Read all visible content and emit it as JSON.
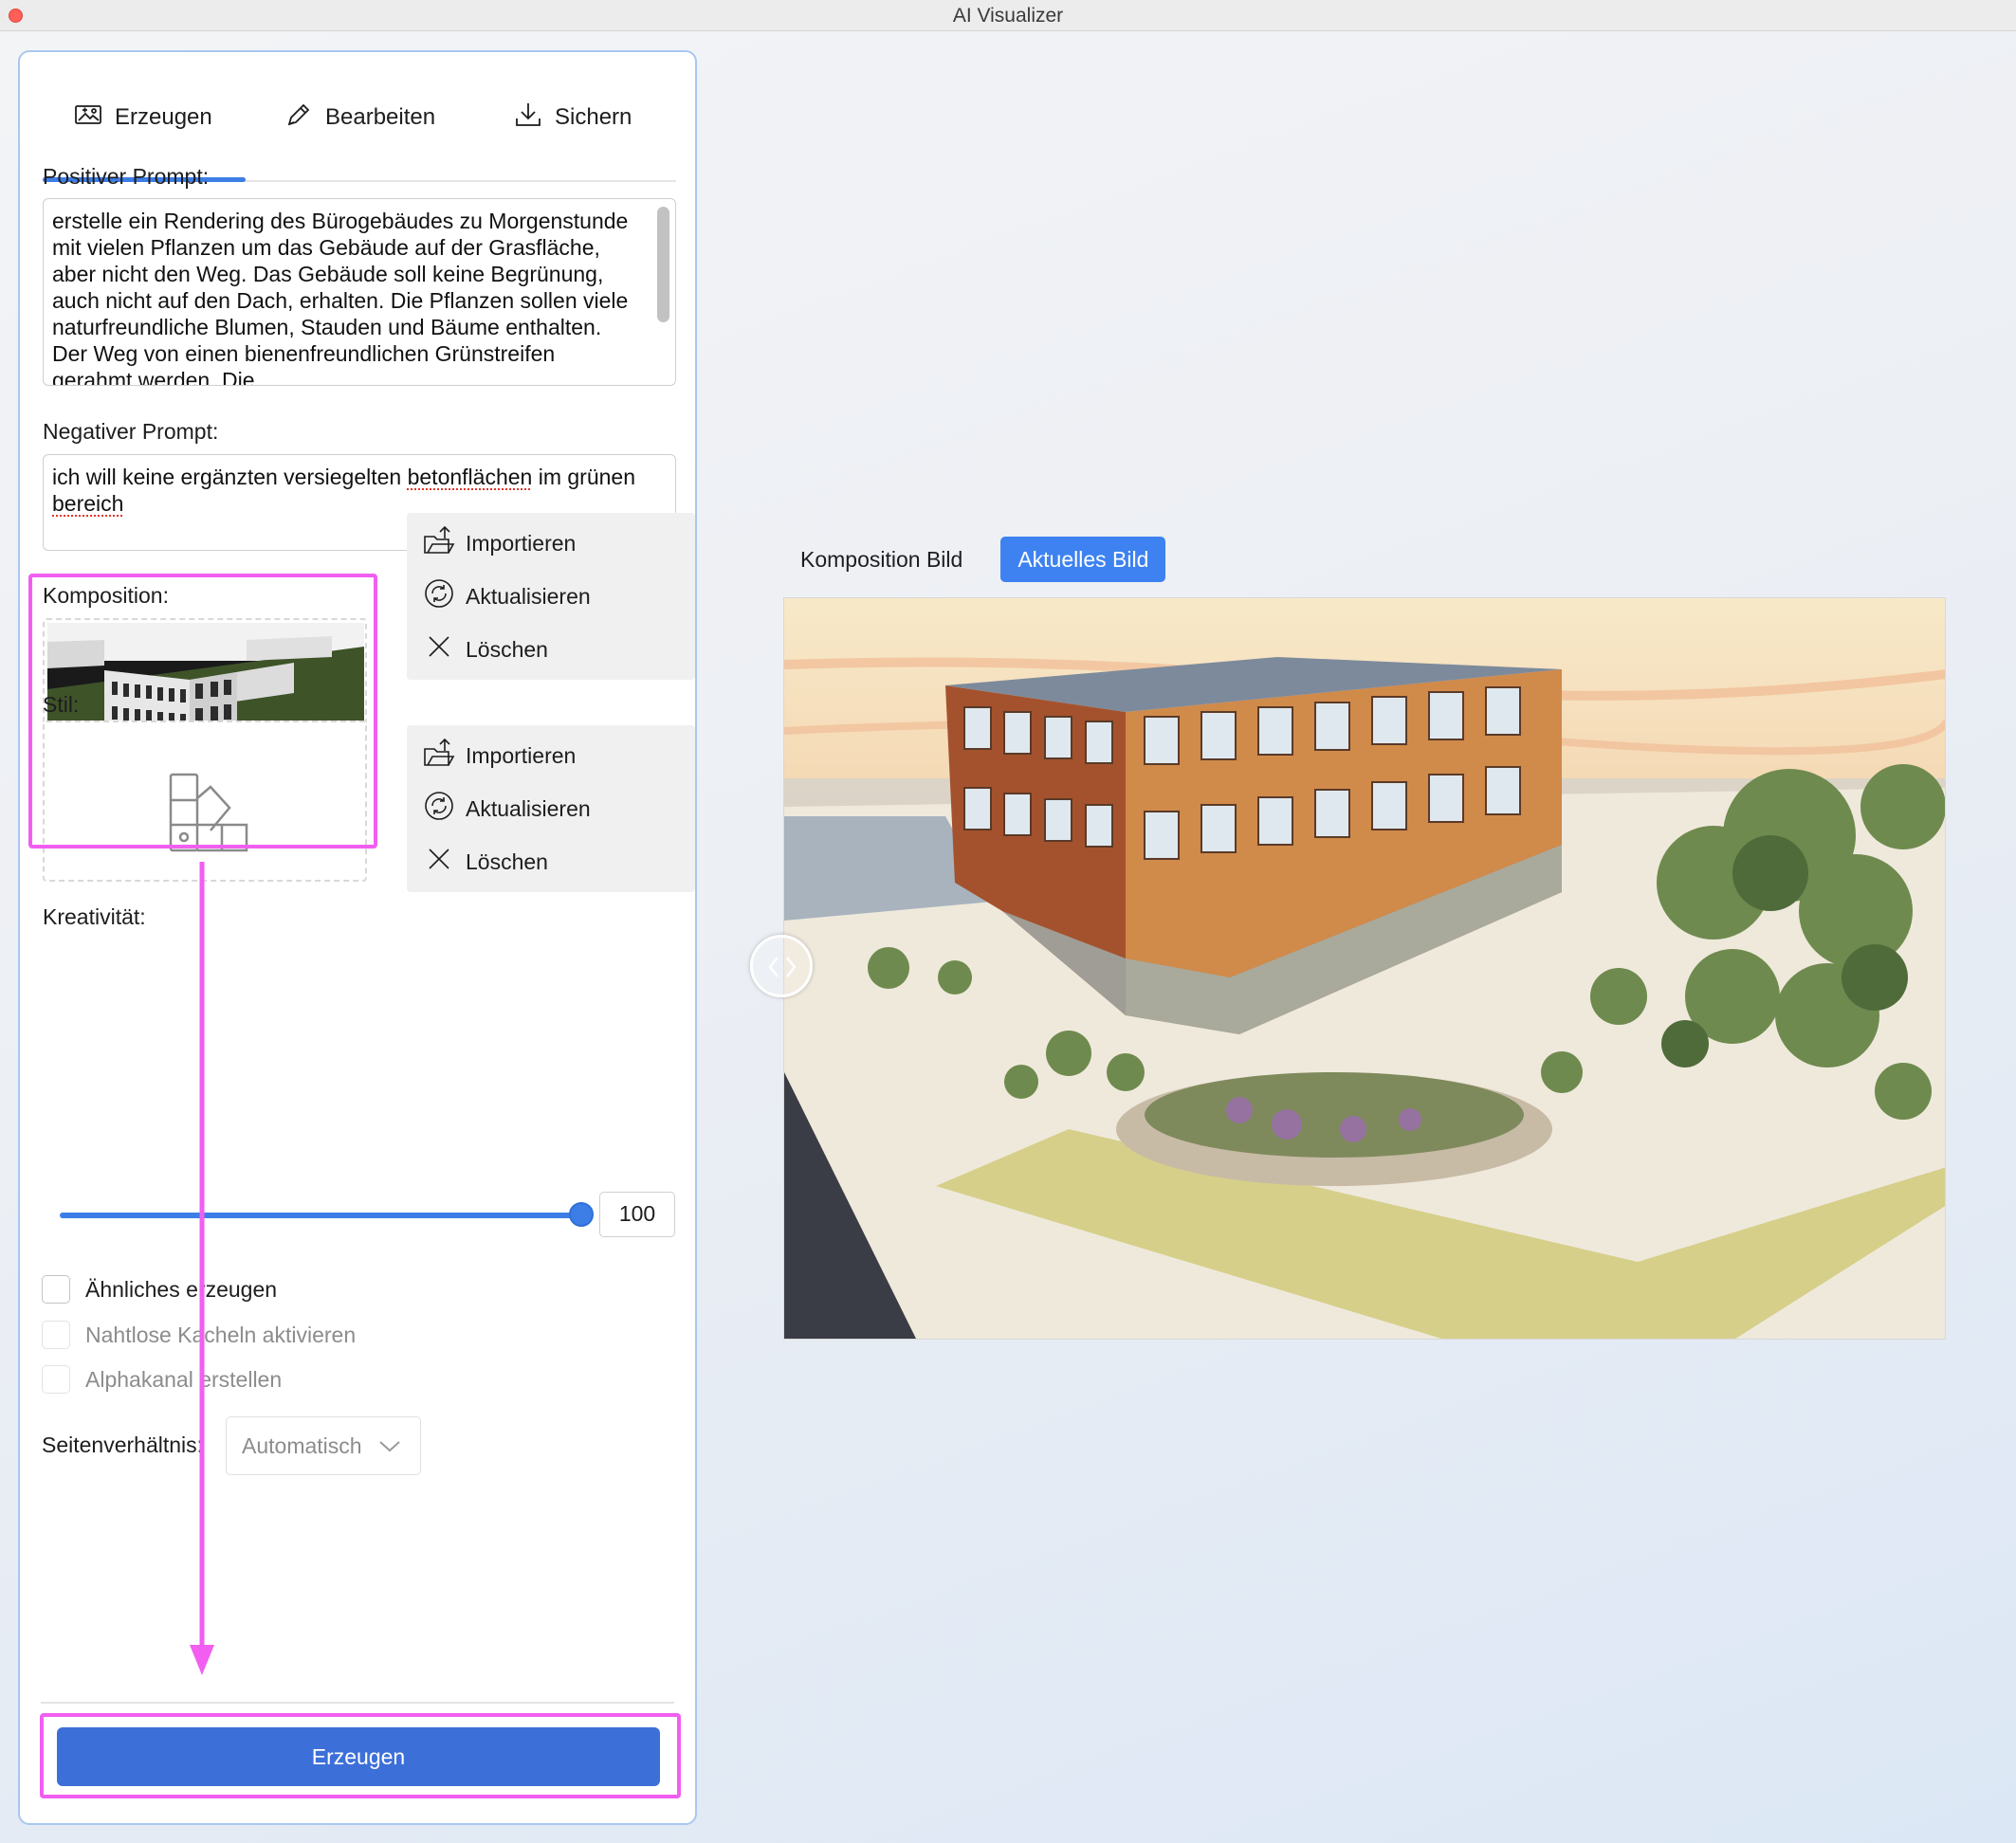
{
  "window": {
    "title": "AI Visualizer"
  },
  "tabs": [
    {
      "label": "Erzeugen",
      "icon": "image-generate-icon",
      "active": true
    },
    {
      "label": "Bearbeiten",
      "icon": "pencil-icon",
      "active": false
    },
    {
      "label": "Sichern",
      "icon": "download-icon",
      "active": false
    }
  ],
  "positive_prompt": {
    "label": "Positiver Prompt:",
    "value": "erstelle ein Rendering des Bürogebäudes zu Morgenstunde mit vielen Pflanzen um das Gebäude auf der Grasfläche, aber nicht den Weg. Das Gebäude soll keine Begrünung, auch nicht auf den Dach, erhalten. Die Pflanzen sollen viele naturfreundliche Blumen, Stauden und Bäume enthalten. Der Weg von einen bienenfreundlichen Grünstreifen gerahmt werden. Die"
  },
  "negative_prompt": {
    "label": "Negativer Prompt:",
    "value_part1": "ich will keine ergänzten versiegelten ",
    "value_misspelled1": "betonflächen",
    "value_part2": " im grünen ",
    "value_misspelled2": "bereich"
  },
  "composition": {
    "label": "Komposition:",
    "import_label": "Importieren",
    "update_label": "Aktualisieren",
    "delete_label": "Löschen"
  },
  "style": {
    "label": "Stil:",
    "placeholder_icon": "style-swatches-icon",
    "import_label": "Importieren",
    "update_label": "Aktualisieren",
    "delete_label": "Löschen"
  },
  "creativity": {
    "label": "Kreativität:",
    "value": "100",
    "fraction": 1.0
  },
  "options": [
    {
      "label": "Ähnliches erzeugen",
      "checked": false,
      "disabled": false
    },
    {
      "label": "Nahtlose Kacheln aktivieren",
      "checked": false,
      "disabled": true
    },
    {
      "label": "Alphakanal erstellen",
      "checked": false,
      "disabled": true
    }
  ],
  "aspect_ratio": {
    "label": "Seitenverhältnis:",
    "value": "Automatisch"
  },
  "generate_button": {
    "label": "Erzeugen"
  },
  "view_tabs": [
    {
      "label": "Komposition Bild",
      "active": false
    },
    {
      "label": "Aktuelles Bild",
      "active": true
    }
  ],
  "colors": {
    "accent": "#3d7de6",
    "primary_button": "#3d6fd9",
    "annotation": "#f15ef0"
  }
}
